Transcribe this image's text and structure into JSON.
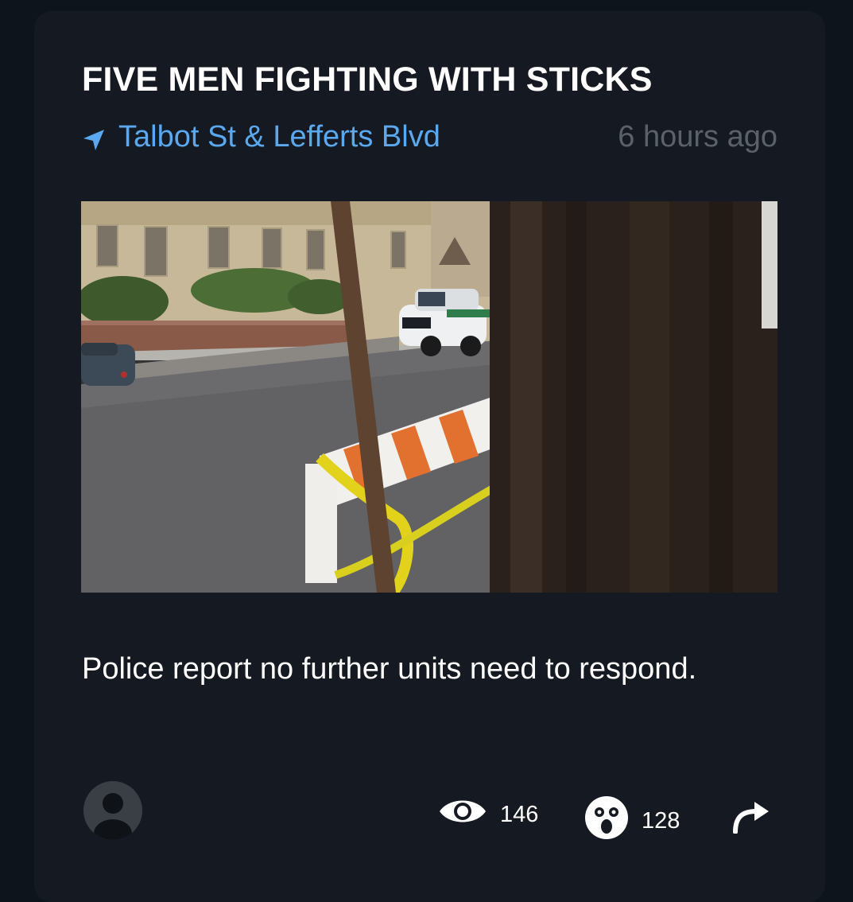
{
  "post": {
    "title": "FIVE MEN FIGHTING WITH STICKS",
    "location": "Talbot St & Lefferts Blvd",
    "timestamp": "6 hours ago",
    "image_icon": "incident-photo",
    "description": "Police report no further units need to respond."
  },
  "footer": {
    "views": "146",
    "reactions": "128",
    "view_icon": "eye-icon",
    "reaction_icon": "shocked-face-icon",
    "share_icon": "share-arrow-icon"
  },
  "colors": {
    "background": "#0e141b",
    "card": "#151a22",
    "accent": "#5aa9f0",
    "muted": "#5b616a",
    "text": "#ffffff"
  }
}
